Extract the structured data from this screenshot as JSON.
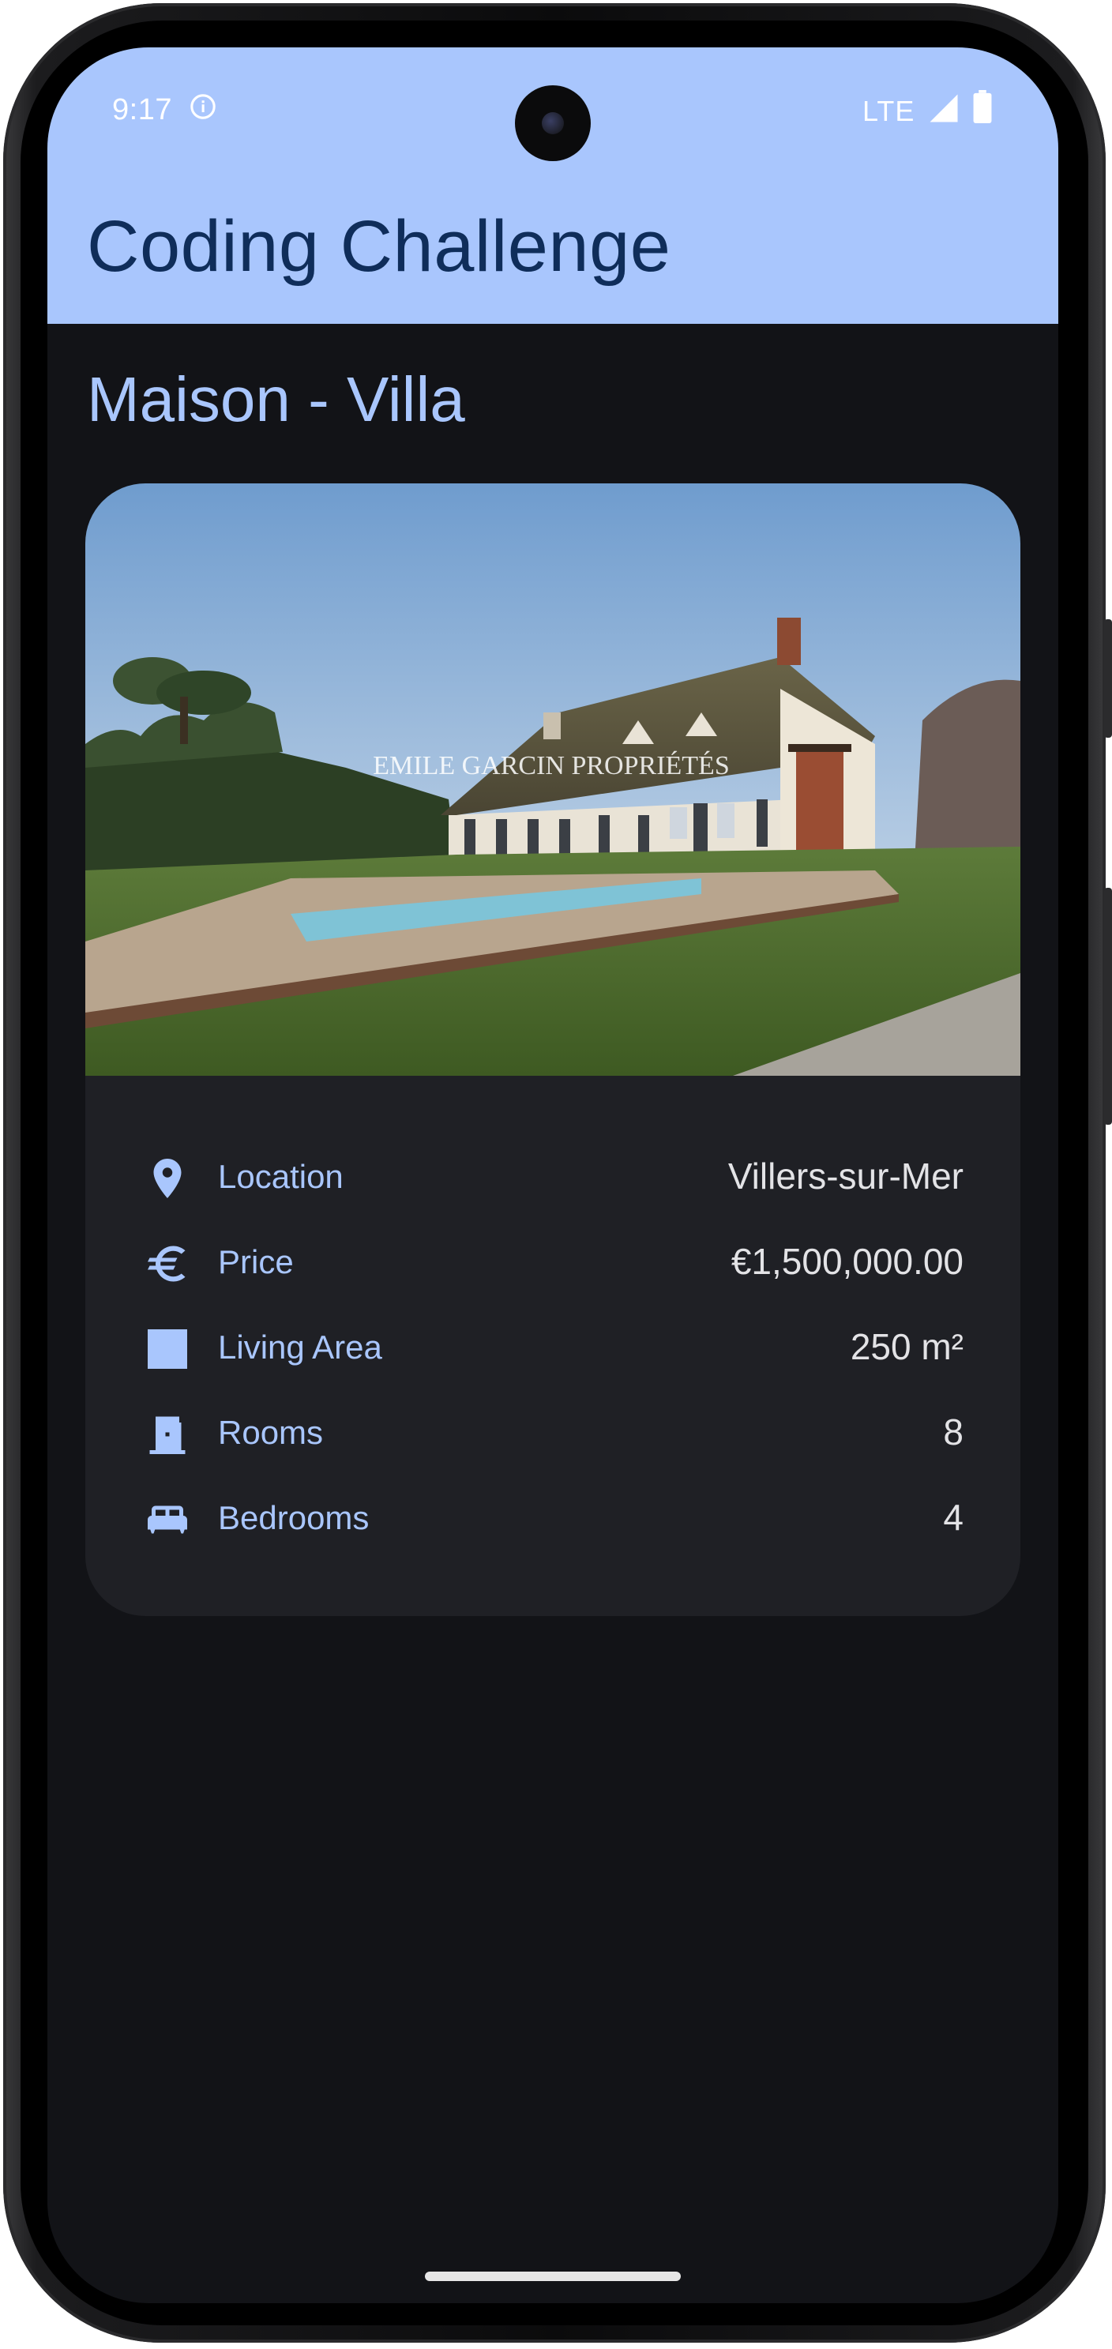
{
  "status_bar": {
    "time": "9:17",
    "network": "LTE",
    "info_icon": "info-icon",
    "signal_icon": "signal-icon",
    "battery_icon": "battery-icon"
  },
  "app_bar": {
    "title": "Coding Challenge"
  },
  "listing": {
    "title": "Maison - Villa",
    "photo_watermark": "EMILE GARCIN PROPRIÉTÉS",
    "details": [
      {
        "icon": "location-pin-icon",
        "label": "Location",
        "value": "Villers-sur-Mer"
      },
      {
        "icon": "euro-icon",
        "label": "Price",
        "value": "€1,500,000.00"
      },
      {
        "icon": "square-icon",
        "label": "Living Area",
        "value": "250 m²"
      },
      {
        "icon": "door-icon",
        "label": "Rooms",
        "value": "8"
      },
      {
        "icon": "bed-icon",
        "label": "Bedrooms",
        "value": "4"
      }
    ]
  },
  "colors": {
    "app_bar_background": "#a9c6fd",
    "app_bar_text": "#0f2d5a",
    "screen_background": "#121317",
    "card_background": "#1f2025",
    "accent": "#a9c6fd",
    "value_text": "#e3e3e6"
  }
}
